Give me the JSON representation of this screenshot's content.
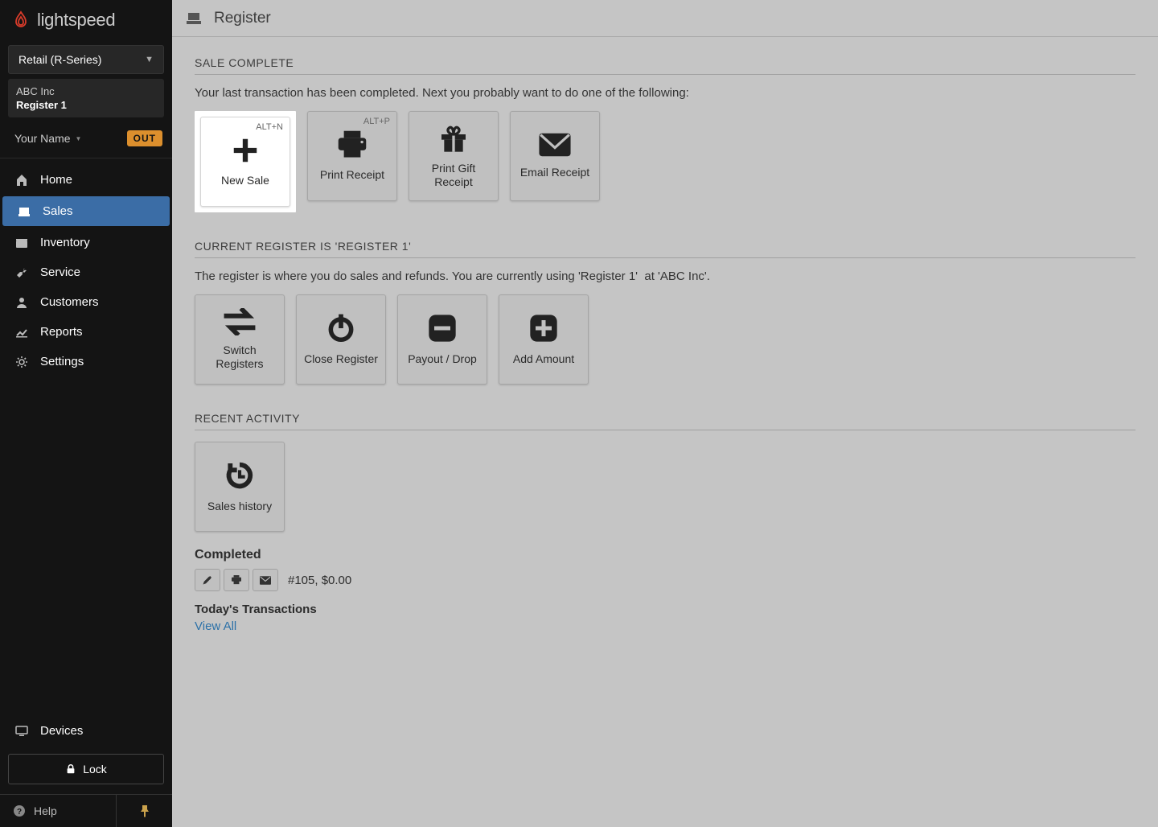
{
  "brand": "lightspeed",
  "product_selector": "Retail (R-Series)",
  "company": "ABC Inc",
  "register": "Register 1",
  "user_name": "Your Name",
  "out_label": "OUT",
  "nav": {
    "home": "Home",
    "sales": "Sales",
    "inventory": "Inventory",
    "service": "Service",
    "customers": "Customers",
    "reports": "Reports",
    "settings": "Settings",
    "devices": "Devices",
    "lock": "Lock",
    "help": "Help"
  },
  "page_title": "Register",
  "sections": {
    "sale_complete": {
      "heading": "SALE COMPLETE",
      "subtext": "Your last transaction has been completed. Next you probably want to do one of the following:",
      "tiles": {
        "new_sale": {
          "label": "New Sale",
          "shortcut": "ALT+N"
        },
        "print_receipt": {
          "label": "Print Receipt",
          "shortcut": "ALT+P"
        },
        "print_gift": {
          "label": "Print Gift Receipt"
        },
        "email_receipt": {
          "label": "Email Receipt"
        }
      }
    },
    "current_register": {
      "heading": "CURRENT REGISTER IS 'REGISTER 1'",
      "subtext": "The register is where you do sales and refunds. You are currently using 'Register 1'  at 'ABC Inc'.",
      "tiles": {
        "switch": "Switch Registers",
        "close": "Close Register",
        "payout": "Payout / Drop",
        "add": "Add Amount"
      }
    },
    "recent": {
      "heading": "RECENT ACTIVITY",
      "tiles": {
        "history": "Sales history"
      },
      "completed_label": "Completed",
      "txn": "#105, $0.00",
      "today_label": "Today's Transactions",
      "view_all": "View All"
    }
  }
}
